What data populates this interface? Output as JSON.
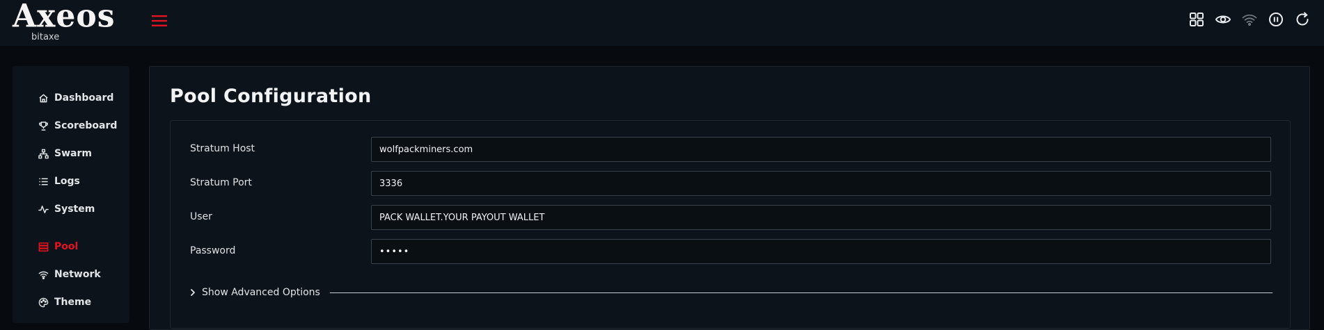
{
  "header": {
    "logo_text": "Axeos",
    "logo_sub": "bitaxe",
    "icons": [
      "grid-icon",
      "eye-icon",
      "wifi-icon",
      "pause-icon",
      "refresh-icon"
    ]
  },
  "sidebar": {
    "items": [
      {
        "label": "Dashboard",
        "icon": "home-icon"
      },
      {
        "label": "Scoreboard",
        "icon": "trophy-icon"
      },
      {
        "label": "Swarm",
        "icon": "sitemap-icon"
      },
      {
        "label": "Logs",
        "icon": "list-icon"
      },
      {
        "label": "System",
        "icon": "activity-icon"
      },
      {
        "label": "Pool",
        "icon": "server-icon"
      },
      {
        "label": "Network",
        "icon": "wifi-icon"
      },
      {
        "label": "Theme",
        "icon": "palette-icon"
      }
    ],
    "active": "Pool"
  },
  "main": {
    "title": "Pool Configuration",
    "fields": [
      {
        "label": "Stratum Host",
        "value": "wolfpackminers.com"
      },
      {
        "label": "Stratum Port",
        "value": "3336"
      },
      {
        "label": "User",
        "value": "PACK WALLET.YOUR PAYOUT WALLET"
      },
      {
        "label": "Password",
        "value": "•••••"
      }
    ],
    "advanced_label": "Show Advanced Options"
  },
  "colors": {
    "accent": "#e5121f",
    "background": "#070b10",
    "panel": "#0d131a"
  }
}
